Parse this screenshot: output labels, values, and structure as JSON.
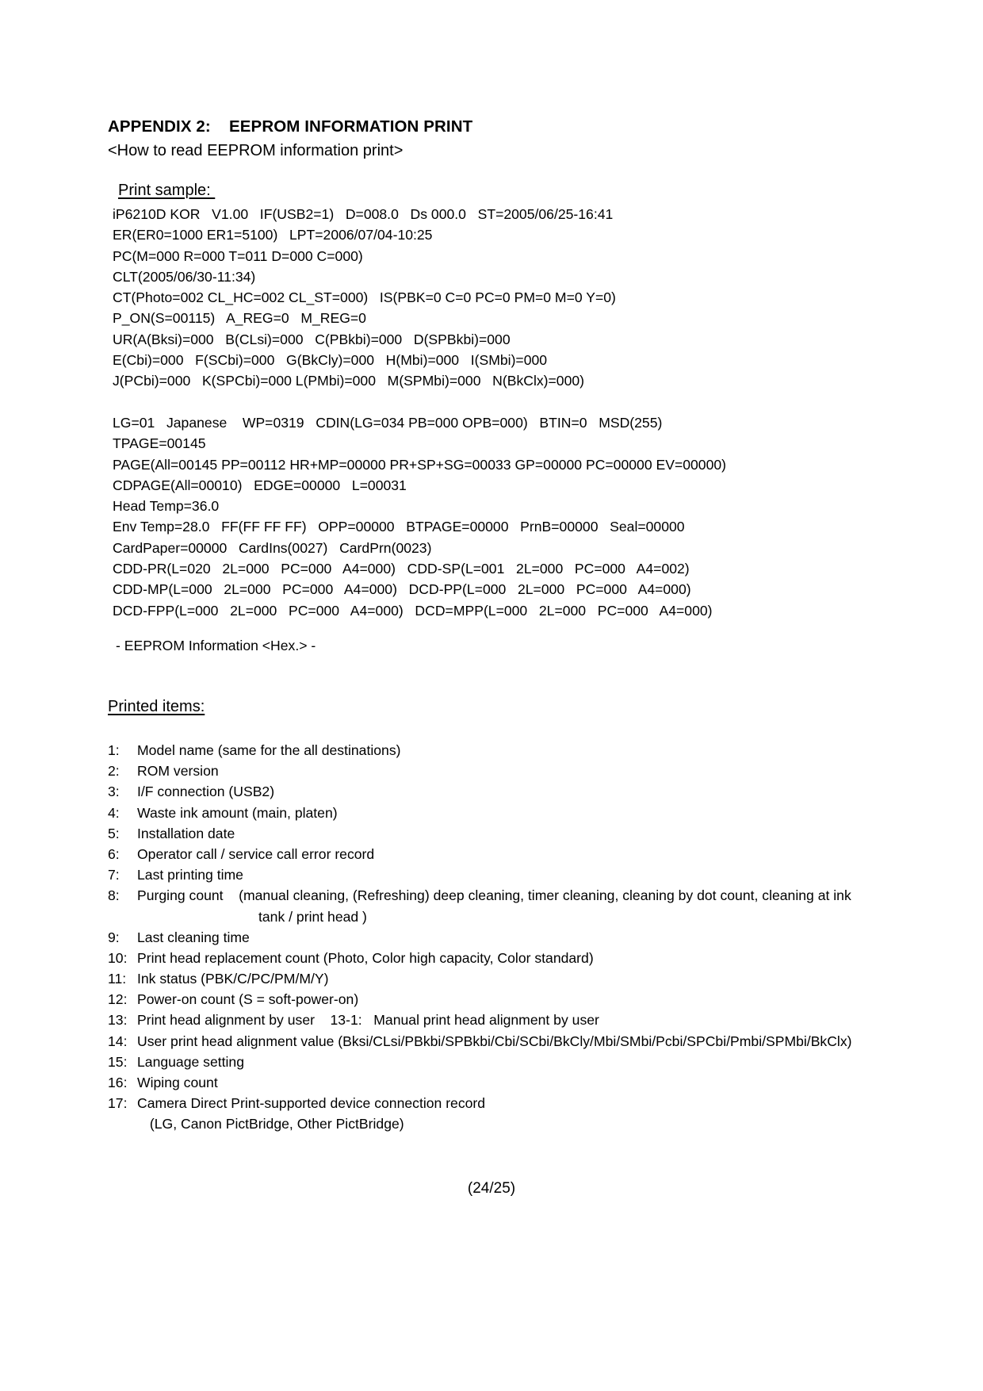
{
  "document": {
    "appendix_title": "APPENDIX 2:    EEPROM INFORMATION PRINT",
    "subtitle": "<How to read EEPROM information print>",
    "print_sample_heading": "Print sample: ",
    "printed_items_heading": "Printed items:",
    "hex_note": "- EEPROM Information <Hex.> -",
    "footer": "(24/25)"
  },
  "sample_lines": [
    "iP6210D KOR   V1.00   IF(USB2=1)   D=008.0   Ds 000.0   ST=2005/06/25-16:41",
    "ER(ER0=1000 ER1=5100)   LPT=2006/07/04-10:25",
    "PC(M=000 R=000 T=011 D=000 C=000)",
    "CLT(2005/06/30-11:34)",
    "CT(Photo=002 CL_HC=002 CL_ST=000)   IS(PBK=0 C=0 PC=0 PM=0 M=0 Y=0)",
    "P_ON(S=00115)   A_REG=0   M_REG=0",
    "UR(A(Bksi)=000   B(CLsi)=000   C(PBkbi)=000   D(SPBkbi)=000",
    "E(Cbi)=000   F(SCbi)=000   G(BkCly)=000   H(Mbi)=000   I(SMbi)=000",
    "J(PCbi)=000   K(SPCbi)=000 L(PMbi)=000   M(SPMbi)=000   N(BkClx)=000)",
    "",
    "LG=01   Japanese    WP=0319   CDIN(LG=034 PB=000 OPB=000)   BTIN=0   MSD(255)",
    "TPAGE=00145",
    "PAGE(All=00145 PP=00112 HR+MP=00000 PR+SP+SG=00033 GP=00000 PC=00000 EV=00000)",
    "CDPAGE(All=00010)   EDGE=00000   L=00031",
    "Head Temp=36.0",
    "Env Temp=28.0   FF(FF FF FF)   OPP=00000   BTPAGE=00000   PrnB=00000   Seal=00000",
    "CardPaper=00000   CardIns(0027)   CardPrn(0023)",
    "CDD-PR(L=020   2L=000   PC=000   A4=000)   CDD-SP(L=001   2L=000   PC=000   A4=002)",
    "CDD-MP(L=000   2L=000   PC=000   A4=000)   DCD-PP(L=000   2L=000   PC=000   A4=000)",
    "DCD-FPP(L=000   2L=000   PC=000   A4=000)   DCD=MPP(L=000   2L=000   PC=000   A4=000)"
  ],
  "printed_items": [
    {
      "num": "1:",
      "text": "Model name (same for the all destinations)"
    },
    {
      "num": "2:",
      "text": "ROM version"
    },
    {
      "num": "3:",
      "text": "I/F connection (USB2)"
    },
    {
      "num": "4:",
      "text": "Waste ink amount (main, platen)"
    },
    {
      "num": "5:",
      "text": "Installation date"
    },
    {
      "num": "6:",
      "text": "Operator call / service call error record"
    },
    {
      "num": "7:",
      "text": "Last printing time"
    },
    {
      "num": "8:",
      "text": "Purging count    (manual cleaning, (Refreshing) deep cleaning, timer cleaning, cleaning by dot count, cleaning at ink",
      "continuation": "tank / print head )"
    },
    {
      "num": "9:",
      "text": "Last cleaning time"
    },
    {
      "num": "10:",
      "text": "Print head replacement count (Photo, Color high capacity, Color standard)"
    },
    {
      "num": "11:",
      "text": "Ink status (PBK/C/PC/PM/M/Y)"
    },
    {
      "num": "12:",
      "text": "Power-on count (S = soft-power-on)"
    },
    {
      "num": "13:",
      "text": "Print head alignment by user    13-1:   Manual print head alignment by user"
    },
    {
      "num": "14:",
      "text": "User print head alignment value (Bksi/CLsi/PBkbi/SPBkbi/Cbi/SCbi/BkCly/Mbi/SMbi/Pcbi/SPCbi/Pmbi/SPMbi/BkClx)"
    },
    {
      "num": "15:",
      "text": "Language setting"
    },
    {
      "num": "16:",
      "text": "Wiping count"
    },
    {
      "num": "17:",
      "text": "Camera Direct Print-supported device connection record",
      "continuation2": " (LG, Canon PictBridge, Other PictBridge)"
    }
  ]
}
